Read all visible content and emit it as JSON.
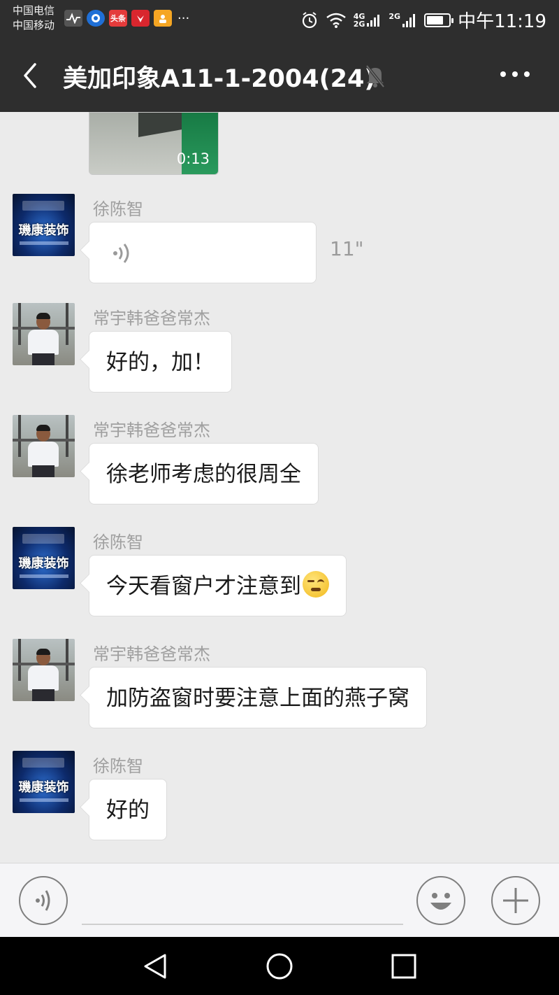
{
  "status_bar": {
    "carrier_1": "中国电信",
    "carrier_2": "中国移动",
    "network_upper": "4G",
    "network_lower": "2G",
    "network_2": "2G",
    "time": "中午11:19",
    "battery_level": 0.8
  },
  "header": {
    "title": "美加印象A11-1-2004(24)",
    "muted": true
  },
  "video": {
    "duration": "0:13"
  },
  "messages": [
    {
      "sender": "徐陈智",
      "type": "voice",
      "duration": "11\"",
      "avatar": "logo"
    },
    {
      "sender": "常宇韩爸爸常杰",
      "type": "text",
      "text": "好的，加！",
      "avatar": "photo"
    },
    {
      "sender": "常宇韩爸爸常杰",
      "type": "text",
      "text": "徐老师考虑的很周全",
      "avatar": "photo"
    },
    {
      "sender": "徐陈智",
      "type": "text",
      "text": "今天看窗户才注意到",
      "emoji": "smirk-emoji",
      "avatar": "logo"
    },
    {
      "sender": "常宇韩爸爸常杰",
      "type": "text",
      "text": "加防盗窗时要注意上面的燕子窝",
      "avatar": "photo"
    },
    {
      "sender": "徐陈智",
      "type": "text",
      "text": "好的",
      "avatar": "logo"
    }
  ],
  "avatar_logo_text": "璣康装饰",
  "colors": {
    "header_bg": "#2e2e2e",
    "chat_bg": "#ebebeb",
    "bubble_bg": "#ffffff",
    "sender_name": "#a0a0a0"
  }
}
